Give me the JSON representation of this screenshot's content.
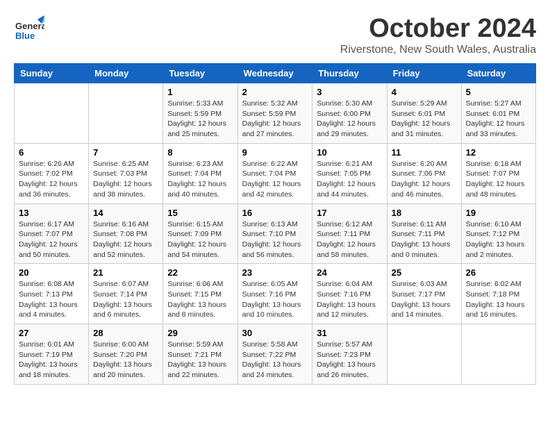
{
  "header": {
    "logo_general": "General",
    "logo_blue": "Blue",
    "month_title": "October 2024",
    "location": "Riverstone, New South Wales, Australia"
  },
  "days_of_week": [
    "Sunday",
    "Monday",
    "Tuesday",
    "Wednesday",
    "Thursday",
    "Friday",
    "Saturday"
  ],
  "weeks": [
    [
      {
        "day": "",
        "content": ""
      },
      {
        "day": "",
        "content": ""
      },
      {
        "day": "1",
        "content": "Sunrise: 5:33 AM\nSunset: 5:59 PM\nDaylight: 12 hours\nand 25 minutes."
      },
      {
        "day": "2",
        "content": "Sunrise: 5:32 AM\nSunset: 5:59 PM\nDaylight: 12 hours\nand 27 minutes."
      },
      {
        "day": "3",
        "content": "Sunrise: 5:30 AM\nSunset: 6:00 PM\nDaylight: 12 hours\nand 29 minutes."
      },
      {
        "day": "4",
        "content": "Sunrise: 5:29 AM\nSunset: 6:01 PM\nDaylight: 12 hours\nand 31 minutes."
      },
      {
        "day": "5",
        "content": "Sunrise: 5:27 AM\nSunset: 6:01 PM\nDaylight: 12 hours\nand 33 minutes."
      }
    ],
    [
      {
        "day": "6",
        "content": "Sunrise: 6:26 AM\nSunset: 7:02 PM\nDaylight: 12 hours\nand 36 minutes."
      },
      {
        "day": "7",
        "content": "Sunrise: 6:25 AM\nSunset: 7:03 PM\nDaylight: 12 hours\nand 38 minutes."
      },
      {
        "day": "8",
        "content": "Sunrise: 6:23 AM\nSunset: 7:04 PM\nDaylight: 12 hours\nand 40 minutes."
      },
      {
        "day": "9",
        "content": "Sunrise: 6:22 AM\nSunset: 7:04 PM\nDaylight: 12 hours\nand 42 minutes."
      },
      {
        "day": "10",
        "content": "Sunrise: 6:21 AM\nSunset: 7:05 PM\nDaylight: 12 hours\nand 44 minutes."
      },
      {
        "day": "11",
        "content": "Sunrise: 6:20 AM\nSunset: 7:06 PM\nDaylight: 12 hours\nand 46 minutes."
      },
      {
        "day": "12",
        "content": "Sunrise: 6:18 AM\nSunset: 7:07 PM\nDaylight: 12 hours\nand 48 minutes."
      }
    ],
    [
      {
        "day": "13",
        "content": "Sunrise: 6:17 AM\nSunset: 7:07 PM\nDaylight: 12 hours\nand 50 minutes."
      },
      {
        "day": "14",
        "content": "Sunrise: 6:16 AM\nSunset: 7:08 PM\nDaylight: 12 hours\nand 52 minutes."
      },
      {
        "day": "15",
        "content": "Sunrise: 6:15 AM\nSunset: 7:09 PM\nDaylight: 12 hours\nand 54 minutes."
      },
      {
        "day": "16",
        "content": "Sunrise: 6:13 AM\nSunset: 7:10 PM\nDaylight: 12 hours\nand 56 minutes."
      },
      {
        "day": "17",
        "content": "Sunrise: 6:12 AM\nSunset: 7:11 PM\nDaylight: 12 hours\nand 58 minutes."
      },
      {
        "day": "18",
        "content": "Sunrise: 6:11 AM\nSunset: 7:11 PM\nDaylight: 13 hours\nand 0 minutes."
      },
      {
        "day": "19",
        "content": "Sunrise: 6:10 AM\nSunset: 7:12 PM\nDaylight: 13 hours\nand 2 minutes."
      }
    ],
    [
      {
        "day": "20",
        "content": "Sunrise: 6:08 AM\nSunset: 7:13 PM\nDaylight: 13 hours\nand 4 minutes."
      },
      {
        "day": "21",
        "content": "Sunrise: 6:07 AM\nSunset: 7:14 PM\nDaylight: 13 hours\nand 6 minutes."
      },
      {
        "day": "22",
        "content": "Sunrise: 6:06 AM\nSunset: 7:15 PM\nDaylight: 13 hours\nand 8 minutes."
      },
      {
        "day": "23",
        "content": "Sunrise: 6:05 AM\nSunset: 7:16 PM\nDaylight: 13 hours\nand 10 minutes."
      },
      {
        "day": "24",
        "content": "Sunrise: 6:04 AM\nSunset: 7:16 PM\nDaylight: 13 hours\nand 12 minutes."
      },
      {
        "day": "25",
        "content": "Sunrise: 6:03 AM\nSunset: 7:17 PM\nDaylight: 13 hours\nand 14 minutes."
      },
      {
        "day": "26",
        "content": "Sunrise: 6:02 AM\nSunset: 7:18 PM\nDaylight: 13 hours\nand 16 minutes."
      }
    ],
    [
      {
        "day": "27",
        "content": "Sunrise: 6:01 AM\nSunset: 7:19 PM\nDaylight: 13 hours\nand 18 minutes."
      },
      {
        "day": "28",
        "content": "Sunrise: 6:00 AM\nSunset: 7:20 PM\nDaylight: 13 hours\nand 20 minutes."
      },
      {
        "day": "29",
        "content": "Sunrise: 5:59 AM\nSunset: 7:21 PM\nDaylight: 13 hours\nand 22 minutes."
      },
      {
        "day": "30",
        "content": "Sunrise: 5:58 AM\nSunset: 7:22 PM\nDaylight: 13 hours\nand 24 minutes."
      },
      {
        "day": "31",
        "content": "Sunrise: 5:57 AM\nSunset: 7:23 PM\nDaylight: 13 hours\nand 26 minutes."
      },
      {
        "day": "",
        "content": ""
      },
      {
        "day": "",
        "content": ""
      }
    ]
  ]
}
